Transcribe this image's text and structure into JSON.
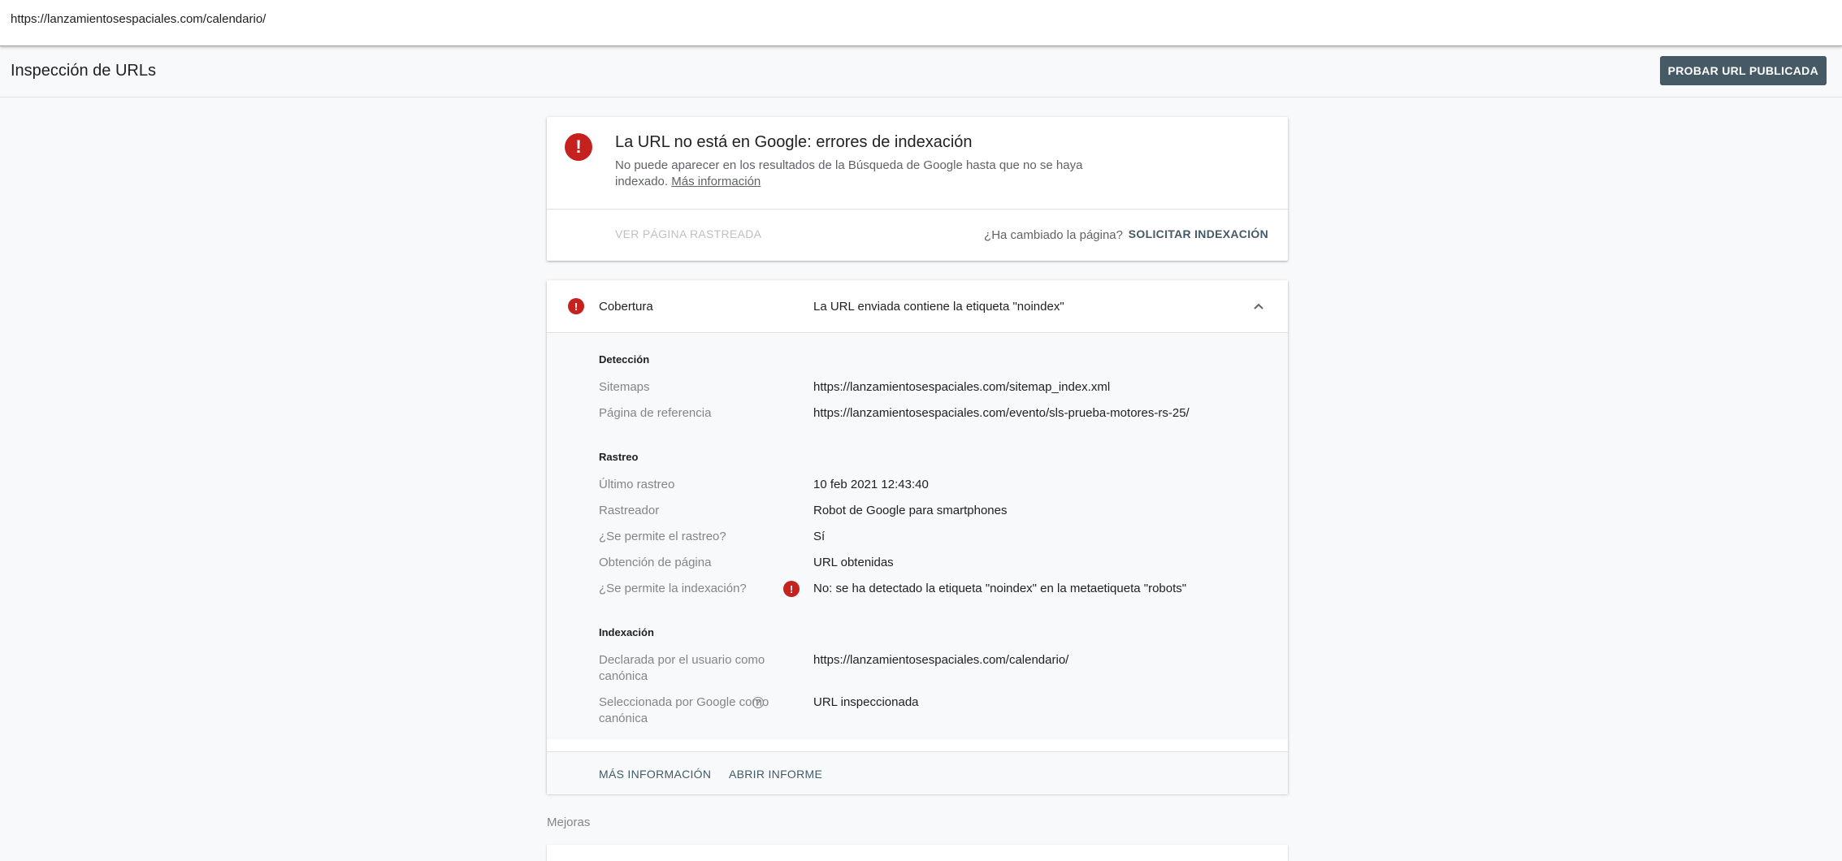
{
  "address_bar": {
    "url": "https://lanzamientosespaciales.com/calendario/"
  },
  "header": {
    "title": "Inspección de URLs",
    "test_live_label": "PROBAR URL PUBLICADA"
  },
  "status_card": {
    "icon": "error-icon",
    "title": "La URL no está en Google: errores de indexación",
    "description": "No puede aparecer en los resultados de la Búsqueda de Google hasta que no se haya indexado.",
    "more_info_link": "Más información",
    "view_crawled_label": "VER PÁGINA RASTREADA",
    "changed_question": "¿Ha cambiado la página?",
    "request_indexing_label": "SOLICITAR INDEXACIÓN"
  },
  "coverage": {
    "label": "Cobertura",
    "value": "La URL enviada contiene la etiqueta \"noindex\"",
    "expanded_icon": "chevron-up-icon",
    "sections": {
      "detection": {
        "title": "Detección",
        "sitemaps_label": "Sitemaps",
        "sitemaps_value": "https://lanzamientosespaciales.com/sitemap_index.xml",
        "referring_label": "Página de referencia",
        "referring_value": "https://lanzamientosespaciales.com/evento/sls-prueba-motores-rs-25/"
      },
      "crawl": {
        "title": "Rastreo",
        "last_crawl_label": "Último rastreo",
        "last_crawl_value": "10 feb 2021 12:43:40",
        "crawler_label": "Rastreador",
        "crawler_value": "Robot de Google para smartphones",
        "crawl_allowed_label": "¿Se permite el rastreo?",
        "crawl_allowed_value": "Sí",
        "page_fetch_label": "Obtención de página",
        "page_fetch_value": "URL obtenidas",
        "indexing_allowed_label": "¿Se permite la indexación?",
        "indexing_allowed_value": "No: se ha detectado la etiqueta \"noindex\" en la metaetiqueta \"robots\""
      },
      "indexing": {
        "title": "Indexación",
        "user_canonical_label": "Declarada por el usuario como canónica",
        "user_canonical_value": "https://lanzamientosespaciales.com/calendario/",
        "google_canonical_label": "Seleccionada por Google como canónica",
        "google_canonical_value": "URL inspeccionada"
      }
    },
    "footer": {
      "more_info_label": "MÁS INFORMACIÓN",
      "open_report_label": "ABRIR INFORME"
    }
  },
  "enhancements": {
    "label": "Mejoras"
  },
  "colors": {
    "error": "#c5221f",
    "primary_button": "#455a64",
    "background": "#f8f9fa"
  }
}
